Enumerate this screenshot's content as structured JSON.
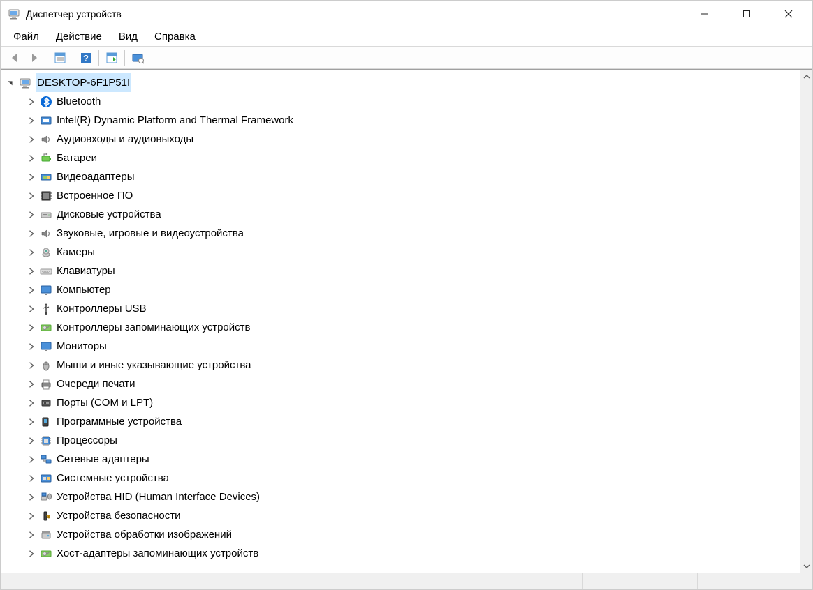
{
  "window": {
    "title": "Диспетчер устройств"
  },
  "menu": {
    "file": "Файл",
    "action": "Действие",
    "view": "Вид",
    "help": "Справка"
  },
  "tree": {
    "root": "DESKTOP-6F1P51I",
    "items": [
      {
        "label": "Bluetooth",
        "icon": "bluetooth"
      },
      {
        "label": "Intel(R) Dynamic Platform and Thermal Framework",
        "icon": "thermal"
      },
      {
        "label": "Аудиовходы и аудиовыходы",
        "icon": "speaker"
      },
      {
        "label": "Батареи",
        "icon": "battery"
      },
      {
        "label": "Видеоадаптеры",
        "icon": "display-card"
      },
      {
        "label": "Встроенное ПО",
        "icon": "firmware"
      },
      {
        "label": "Дисковые устройства",
        "icon": "disk"
      },
      {
        "label": "Звуковые, игровые и видеоустройства",
        "icon": "speaker"
      },
      {
        "label": "Камеры",
        "icon": "camera"
      },
      {
        "label": "Клавиатуры",
        "icon": "keyboard"
      },
      {
        "label": "Компьютер",
        "icon": "monitor"
      },
      {
        "label": "Контроллеры USB",
        "icon": "usb"
      },
      {
        "label": "Контроллеры запоминающих устройств",
        "icon": "storage"
      },
      {
        "label": "Мониторы",
        "icon": "monitor"
      },
      {
        "label": "Мыши и иные указывающие устройства",
        "icon": "mouse"
      },
      {
        "label": "Очереди печати",
        "icon": "printer"
      },
      {
        "label": "Порты (COM и LPT)",
        "icon": "port"
      },
      {
        "label": "Программные устройства",
        "icon": "software"
      },
      {
        "label": "Процессоры",
        "icon": "cpu"
      },
      {
        "label": "Сетевые адаптеры",
        "icon": "network"
      },
      {
        "label": "Системные устройства",
        "icon": "system"
      },
      {
        "label": "Устройства HID (Human Interface Devices)",
        "icon": "hid"
      },
      {
        "label": "Устройства безопасности",
        "icon": "security"
      },
      {
        "label": "Устройства обработки изображений",
        "icon": "imaging"
      },
      {
        "label": "Хост-адаптеры запоминающих устройств",
        "icon": "storage"
      }
    ]
  }
}
